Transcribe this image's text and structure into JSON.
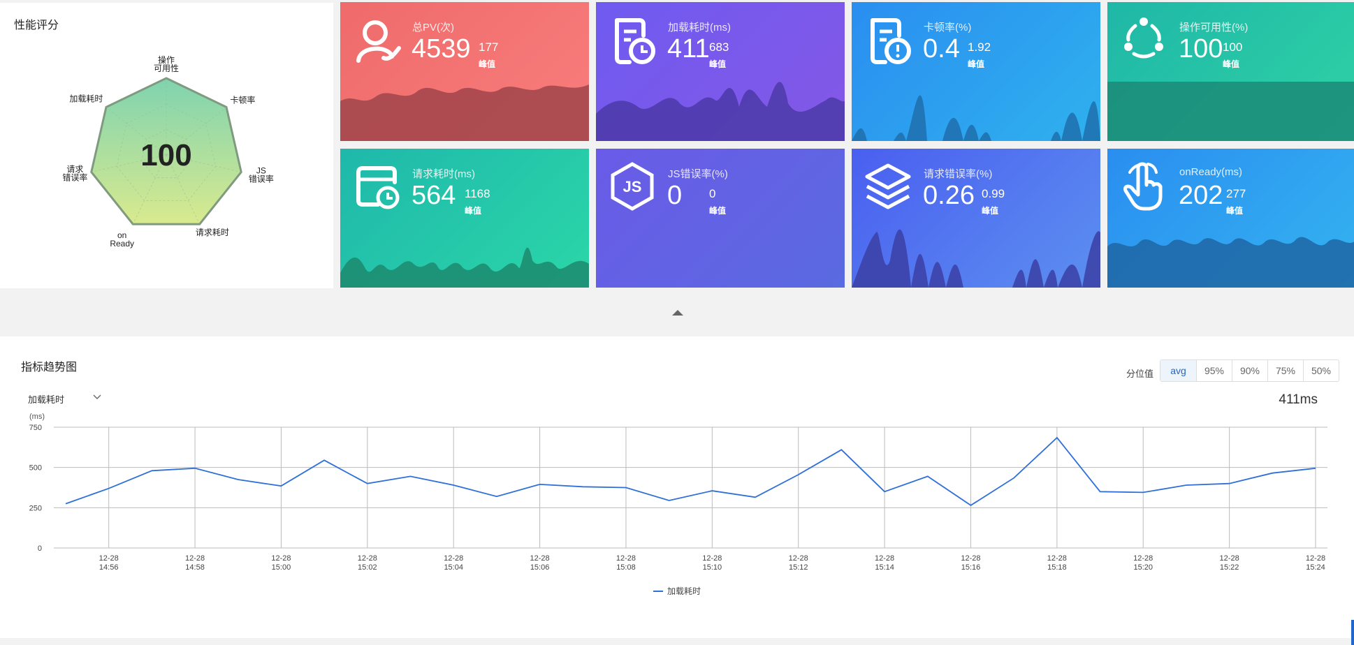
{
  "radar": {
    "title": "性能评分",
    "score": "100",
    "axes": [
      {
        "line1": "操作",
        "line2": "可用性"
      },
      {
        "line1": "卡顿率",
        "line2": ""
      },
      {
        "line1": "JS",
        "line2": "错误率"
      },
      {
        "line1": "请求耗时",
        "line2": ""
      },
      {
        "line1": "on",
        "line2": "Ready"
      },
      {
        "line1": "请求",
        "line2": "错误率"
      },
      {
        "line1": "加载耗时",
        "line2": ""
      }
    ]
  },
  "cards": [
    {
      "label": "总PV(次)",
      "value": "4539",
      "peak": "177",
      "peak_label": "峰值",
      "icon": "user-trend-icon",
      "grad_from": "#ef6b6b",
      "grad_to": "#f87d7c",
      "wave_color": "#a0444a",
      "peak_fill": 0.45
    },
    {
      "label": "加载耗时(ms)",
      "value": "411",
      "peak": "683",
      "peak_label": "峰值",
      "icon": "document-clock-icon",
      "grad_from": "#6f5af0",
      "grad_to": "#8458e6",
      "wave_color": "#4b3aa8",
      "peak_fill": 0.45
    },
    {
      "label": "卡顿率(%)",
      "value": "0.4",
      "peak": "1.92",
      "peak_label": "峰值",
      "icon": "document-alert-icon",
      "grad_from": "#2a8ef0",
      "grad_to": "#2fb1ee",
      "wave_color": "#1f6eab",
      "peak_fill": 0.45
    },
    {
      "label": "操作可用性(%)",
      "value": "100",
      "peak": "100",
      "peak_label": "峰值",
      "icon": "share-nodes-icon",
      "grad_from": "#1fb7a7",
      "grad_to": "#2fd2a6",
      "wave_color": "#1b8b77",
      "peak_fill": 0.45
    },
    {
      "label": "请求耗时(ms)",
      "value": "564",
      "peak": "1168",
      "peak_label": "峰值",
      "icon": "calendar-clock-icon",
      "grad_from": "#1fb8ab",
      "grad_to": "#2bd6a8",
      "wave_color": "#1c8a6e",
      "peak_fill": 0.45
    },
    {
      "label": "JS错误率(%)",
      "value": "0",
      "peak": "0",
      "peak_label": "峰值",
      "icon": "nodejs-icon",
      "grad_from": "#6a5be8",
      "grad_to": "#5a6ae0",
      "wave_color": "#4a40b0",
      "peak_fill": 0.45
    },
    {
      "label": "请求错误率(%)",
      "value": "0.26",
      "peak": "0.99",
      "peak_label": "峰值",
      "icon": "layers-icon",
      "grad_from": "#4a5ff0",
      "grad_to": "#5c8ff0",
      "wave_color": "#3b3fa5",
      "peak_fill": 0.45
    },
    {
      "label": "onReady(ms)",
      "value": "202",
      "peak": "277",
      "peak_label": "峰值",
      "icon": "hand-pointer-icon",
      "grad_from": "#2a8ef0",
      "grad_to": "#34b3f0",
      "wave_color": "#1f66a5",
      "peak_fill": 0.45
    }
  ],
  "trend": {
    "title": "指标趋势图",
    "percentile_label": "分位值",
    "percentiles": [
      "avg",
      "95%",
      "90%",
      "75%",
      "50%"
    ],
    "active_percentile": "avg",
    "metric_selected": "加载耗时",
    "current_value": "411ms"
  },
  "chart_data": {
    "type": "line",
    "ylabel": "(ms)",
    "ylim": [
      0,
      750
    ],
    "yticks": [
      "0",
      "250",
      "500",
      "750"
    ],
    "x": [
      "14:55",
      "14:56",
      "14:57",
      "14:58",
      "14:59",
      "15:00",
      "15:01",
      "15:02",
      "15:03",
      "15:04",
      "15:05",
      "15:06",
      "15:07",
      "15:08",
      "15:09",
      "15:10",
      "15:11",
      "15:12",
      "15:13",
      "15:14",
      "15:15",
      "15:16",
      "15:17",
      "15:18",
      "15:19",
      "15:20",
      "15:21",
      "15:22",
      "15:23",
      "15:24"
    ],
    "xtick_labels": [
      {
        "date": "12-28",
        "time": "14:56"
      },
      {
        "date": "12-28",
        "time": "14:58"
      },
      {
        "date": "12-28",
        "time": "15:00"
      },
      {
        "date": "12-28",
        "time": "15:02"
      },
      {
        "date": "12-28",
        "time": "15:04"
      },
      {
        "date": "12-28",
        "time": "15:06"
      },
      {
        "date": "12-28",
        "time": "15:08"
      },
      {
        "date": "12-28",
        "time": "15:10"
      },
      {
        "date": "12-28",
        "time": "15:12"
      },
      {
        "date": "12-28",
        "time": "15:14"
      },
      {
        "date": "12-28",
        "time": "15:16"
      },
      {
        "date": "12-28",
        "time": "15:18"
      },
      {
        "date": "12-28",
        "time": "15:20"
      },
      {
        "date": "12-28",
        "time": "15:22"
      },
      {
        "date": "12-28",
        "time": "15:24"
      }
    ],
    "series": [
      {
        "name": "加载耗时",
        "color": "#2e6fd8",
        "values": [
          275,
          370,
          480,
          495,
          425,
          385,
          545,
          400,
          445,
          390,
          320,
          395,
          380,
          375,
          295,
          355,
          315,
          455,
          610,
          350,
          445,
          265,
          435,
          685,
          350,
          345,
          390,
          400,
          465,
          495
        ]
      }
    ],
    "legend": "bottom-center",
    "grid": true
  }
}
